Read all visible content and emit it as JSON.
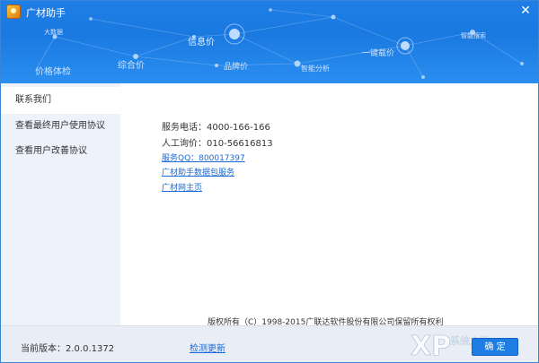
{
  "window": {
    "title": "广材助手",
    "close_icon": "close-icon"
  },
  "banner": {
    "tags": [
      "大数据",
      "信息价",
      "价格体检",
      "综合价",
      "品牌价",
      "智能分析",
      "一键载价",
      "智能搜索"
    ]
  },
  "sidebar": {
    "items": [
      {
        "label": "联系我们",
        "active": true
      },
      {
        "label": "查看最终用户使用协议",
        "active": false
      },
      {
        "label": "查看用户改善协议",
        "active": false
      }
    ]
  },
  "contact": {
    "phone": "服务电话：4000-166-166",
    "manual_query": "人工询价：010-56616813",
    "qq_link": "服务QQ：800017397",
    "data_service_link": "广材助手数据包服务",
    "homepage_link": "广材网主页"
  },
  "copyright": "版权所有（C）1998-2015广联达软件股份有限公司保留所有权利",
  "footer": {
    "version": "当前版本：2.0.0.1372",
    "check_update": "检测更新",
    "ok_button": "确 定"
  },
  "watermark": {
    "text": "系统之家"
  },
  "colors": {
    "accent": "#1f7ee4",
    "link": "#1a6ad6",
    "sidebar_bg": "#eef3fb"
  }
}
